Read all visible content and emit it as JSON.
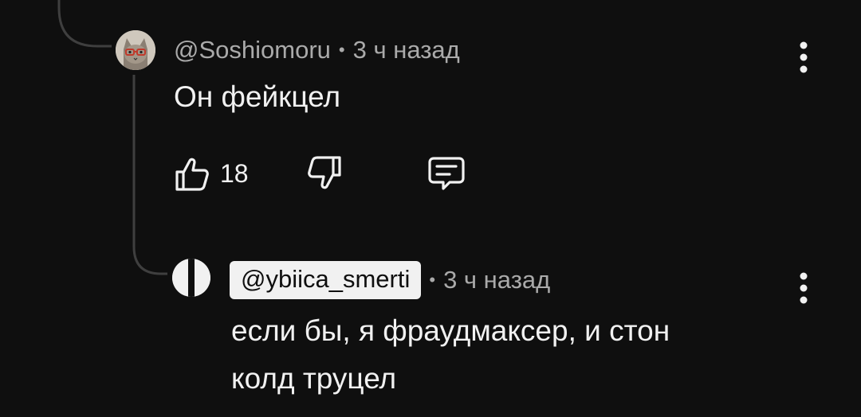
{
  "comments": [
    {
      "author": "@Soshiomoru",
      "time": "3 ч назад",
      "text": "Он фейкцел",
      "likes": "18",
      "avatar_icon": "cat-with-glasses-avatar",
      "menu_icon": "more-vert-icon"
    },
    {
      "author": "@ybiica_smerti",
      "time": "3 ч назад",
      "text_lines": [
        "если бы, я фраудмаксер, и стон",
        "колд труцел"
      ],
      "avatar_icon": "split-circle-avatar",
      "menu_icon": "more-vert-icon",
      "author_highlighted": true
    }
  ],
  "separator": "•",
  "colors": {
    "background": "#0f0f0f",
    "text": "#f1f1f1",
    "meta": "#aaaaaa",
    "thread_line": "#3f3f3f",
    "chip_bg": "#f1f1f1"
  }
}
